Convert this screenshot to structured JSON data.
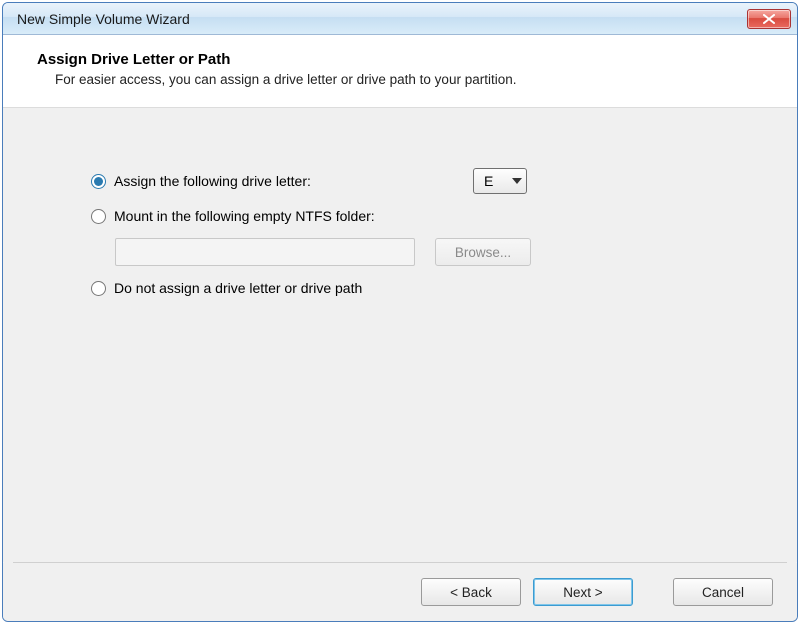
{
  "window": {
    "title": "New Simple Volume Wizard"
  },
  "header": {
    "heading": "Assign Drive Letter or Path",
    "sub": "For easier access, you can assign a drive letter or drive path to your partition."
  },
  "options": {
    "assign_label": "Assign the following drive letter:",
    "selected_letter": "E",
    "mount_label": "Mount in the following empty NTFS folder:",
    "mount_path": "",
    "browse_label": "Browse...",
    "none_label": "Do not assign a drive letter or drive path"
  },
  "footer": {
    "back": "< Back",
    "next": "Next >",
    "cancel": "Cancel"
  }
}
